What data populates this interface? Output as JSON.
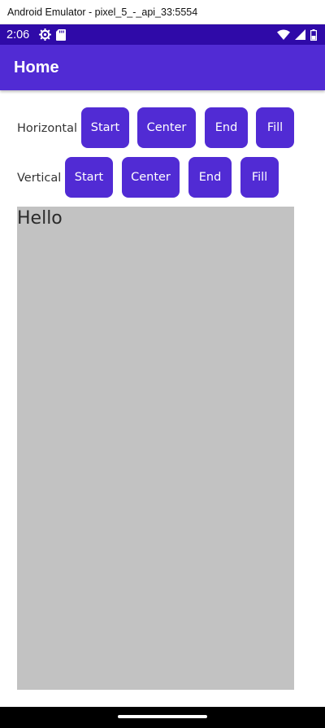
{
  "window": {
    "title": "Android Emulator - pixel_5_-_api_33:5554"
  },
  "status_bar": {
    "time": "2:06",
    "background_color": "#2f0aa8",
    "left_icons": [
      "settings-gear-icon",
      "sd-card-icon"
    ],
    "right_icons": [
      "wifi-icon",
      "cellular-signal-icon",
      "battery-icon"
    ]
  },
  "app_bar": {
    "title": "Home",
    "background_color": "#512bd4"
  },
  "horizontal_row": {
    "label": "Horizontal",
    "buttons": [
      {
        "label": "Start"
      },
      {
        "label": "Center"
      },
      {
        "label": "End"
      },
      {
        "label": "Fill"
      }
    ]
  },
  "vertical_row": {
    "label": "Vertical",
    "buttons": [
      {
        "label": "Start"
      },
      {
        "label": "Center"
      },
      {
        "label": "End"
      },
      {
        "label": "Fill"
      }
    ]
  },
  "content_box": {
    "text": "Hello",
    "background_color": "#c2c2c2"
  },
  "colors": {
    "accent": "#512bd4",
    "button_text": "#ffffff"
  }
}
